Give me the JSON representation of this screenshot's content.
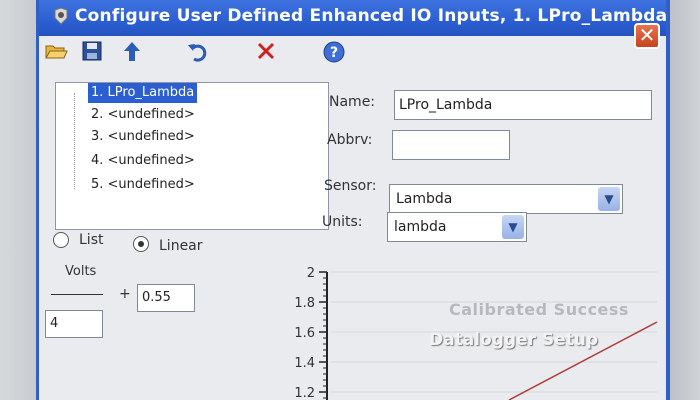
{
  "window": {
    "title": "Configure User Defined Enhanced IO Inputs,  1. LPro_Lambda",
    "close_glyph": "✕"
  },
  "toolbar": {
    "icons": [
      "open-folder-icon",
      "save-icon",
      "up-arrow-icon",
      "undo-icon",
      "delete-icon",
      "help-icon"
    ]
  },
  "tree": {
    "items": [
      {
        "label": "1. LPro_Lambda",
        "selected": true
      },
      {
        "label": "2. <undefined>",
        "selected": false
      },
      {
        "label": "3. <undefined>",
        "selected": false
      },
      {
        "label": "4. <undefined>",
        "selected": false
      },
      {
        "label": "5. <undefined>",
        "selected": false
      }
    ]
  },
  "form": {
    "name_label": "Name:",
    "name_value": "LPro_Lambda",
    "abbrv_label": "Abbrv:",
    "abbrv_value": "",
    "sensor_label": "Sensor:",
    "sensor_value": "Lambda",
    "units_label": "Units:",
    "units_value": "lambda"
  },
  "mode": {
    "list_label": "List",
    "linear_label": "Linear",
    "selected": "Linear"
  },
  "formula": {
    "numerator_label": "Volts",
    "divisor_value": "4",
    "plus_sign": "+",
    "offset_value": "0.55"
  },
  "chart_data": {
    "type": "line",
    "y_ticks": [
      "2",
      "1.8",
      "1.6",
      "1.4",
      "1.2"
    ],
    "ylim": [
      1.2,
      2
    ],
    "grid": true
  },
  "overlay": {
    "brand": "Calibrated Success",
    "caption": "Datalogger Setup"
  },
  "colors": {
    "titlebar": "#2b5ed1",
    "selection": "#2b5ed1",
    "close_button": "#d2502a",
    "delete_icon": "#d02020"
  }
}
